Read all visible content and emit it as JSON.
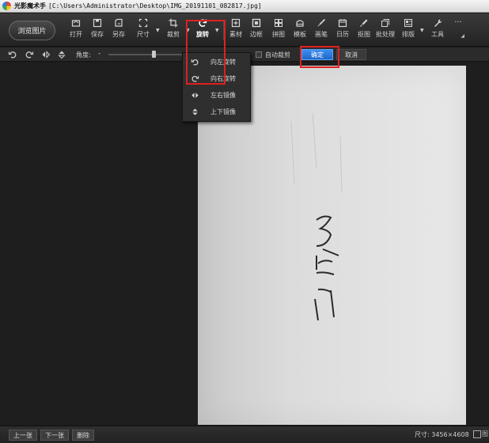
{
  "titlebar": {
    "app_name": "光影魔术手",
    "path": "[C:\\Users\\Administrator\\Desktop\\IMG_20191101_082817.jpg]"
  },
  "toolbar": {
    "browse_label": "浏览图片",
    "tools": [
      {
        "key": "open",
        "label": "打开",
        "icon": "folder-open-icon"
      },
      {
        "key": "save",
        "label": "保存",
        "icon": "save-icon"
      },
      {
        "key": "saveas",
        "label": "另存",
        "icon": "save-as-icon"
      },
      {
        "key": "size",
        "label": "尺寸",
        "icon": "resize-icon"
      },
      {
        "key": "crop",
        "label": "裁剪",
        "icon": "crop-icon"
      },
      {
        "key": "rotate",
        "label": "旋转",
        "icon": "rotate-icon"
      },
      {
        "key": "material",
        "label": "素材",
        "icon": "material-icon"
      },
      {
        "key": "border",
        "label": "边框",
        "icon": "border-icon"
      },
      {
        "key": "collage",
        "label": "拼图",
        "icon": "collage-icon"
      },
      {
        "key": "template",
        "label": "模板",
        "icon": "template-icon"
      },
      {
        "key": "brush",
        "label": "画笔",
        "icon": "brush-icon"
      },
      {
        "key": "calendar",
        "label": "日历",
        "icon": "calendar-icon"
      },
      {
        "key": "cutout",
        "label": "抠图",
        "icon": "cutout-icon"
      },
      {
        "key": "batch",
        "label": "批处理",
        "icon": "batch-icon"
      },
      {
        "key": "layout",
        "label": "排版",
        "icon": "layout-icon"
      },
      {
        "key": "tools",
        "label": "工具",
        "icon": "wrench-icon"
      }
    ],
    "more_label": "···"
  },
  "rotate_bar": {
    "angle_label": "角度:",
    "angle_minus": "-",
    "angle_value_fraction": 0.52,
    "autocrop_label": "自动裁剪",
    "autocrop_checked": false,
    "confirm_label": "确定",
    "cancel_label": "取消"
  },
  "rotate_menu": {
    "items": [
      {
        "label": "向左旋转",
        "icon": "rotate-left-icon"
      },
      {
        "label": "向右旋转",
        "icon": "rotate-right-icon"
      },
      {
        "label": "左右镜像",
        "icon": "flip-horizontal-icon"
      },
      {
        "label": "上下镜像",
        "icon": "flip-vertical-icon"
      }
    ]
  },
  "statusbar": {
    "prev_label": "上一张",
    "next_label": "下一张",
    "delete_label": "删除",
    "size_text": "尺寸: 3456×4608",
    "trailing_label": "图"
  },
  "colors": {
    "confirm_blue": "#2a77e0",
    "highlight_red": "#e02020",
    "toolbar_bg": "#2e2e2e"
  }
}
